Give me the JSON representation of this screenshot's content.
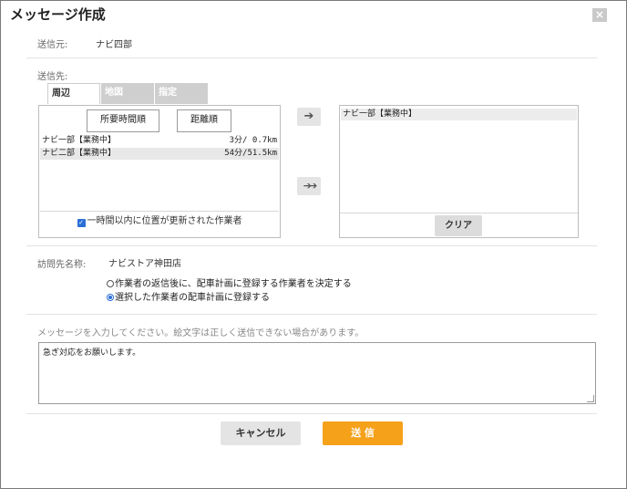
{
  "dialog": {
    "title": "メッセージ作成",
    "close_label": "×"
  },
  "sender": {
    "label": "送信元:",
    "value": "ナビ四部"
  },
  "recipients": {
    "label": "送信先:",
    "tabs": [
      {
        "label": "周辺",
        "active": true
      },
      {
        "label": "地図",
        "active": false
      },
      {
        "label": "指定",
        "active": false
      }
    ],
    "sort_buttons": {
      "time": "所要時間順",
      "distance": "距離順"
    },
    "candidates": [
      {
        "name": "ナビ一部【業務中】",
        "distance": "3分/ 0.7km"
      },
      {
        "name": "ナビ二部【業務中】",
        "distance": "54分/51.5km"
      }
    ],
    "filter_checkbox": {
      "label": "一時間以内に位置が更新された作業者",
      "checked": true
    },
    "add_arrow": "➔",
    "add_all_arrow": "➔➔",
    "selected": [
      "ナビ一部【業務中】"
    ],
    "clear_label": "クリア"
  },
  "destination": {
    "label": "訪問先名称:",
    "value": "ナビストア神田店",
    "options": [
      {
        "label": "作業者の返信後に、配車計画に登録する作業者を決定する",
        "selected": false
      },
      {
        "label": "選択した作業者の配車計画に登録する",
        "selected": true
      }
    ]
  },
  "message": {
    "hint": "メッセージを入力してください。絵文字は正しく送信できない場合があります。",
    "value": "急ぎ対応をお願いします。"
  },
  "footer": {
    "cancel_label": "キャンセル",
    "send_label": "送 信"
  }
}
